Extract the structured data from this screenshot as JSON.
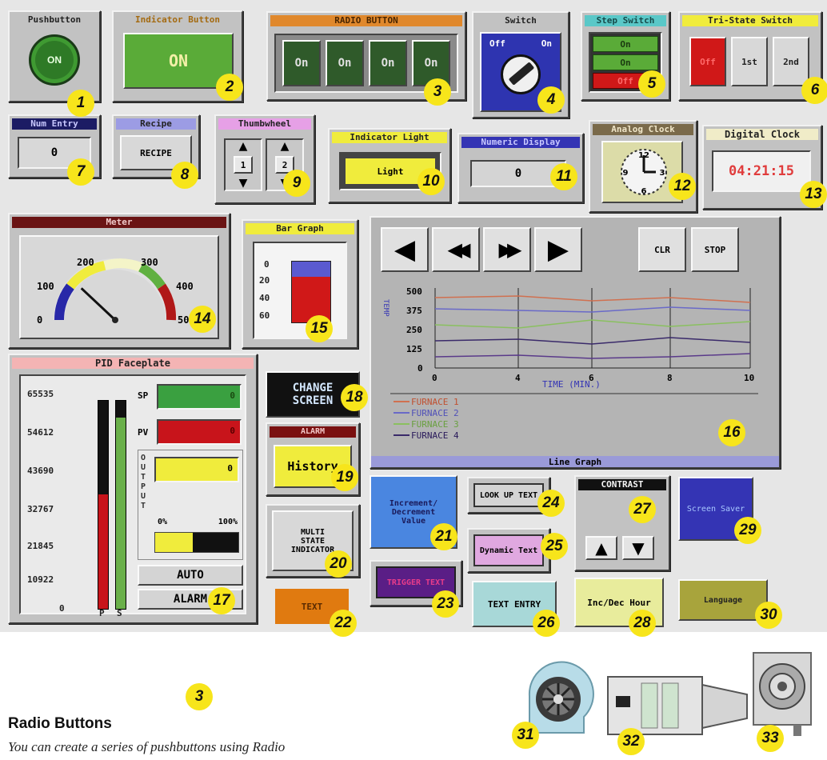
{
  "pushbutton": {
    "title": "Pushbutton",
    "label": "ON"
  },
  "indicator_button": {
    "title": "Indicator Button",
    "label": "ON"
  },
  "radio": {
    "title": "RADIO BUTTON",
    "labels": [
      "On",
      "On",
      "On",
      "On"
    ]
  },
  "switch": {
    "title": "Switch",
    "off": "Off",
    "on": "On"
  },
  "step_switch": {
    "title": "Step Switch",
    "labels": [
      "On",
      "On",
      "Off"
    ]
  },
  "tristate": {
    "title": "Tri-State Switch",
    "labels": [
      "Off",
      "1st",
      "2nd"
    ]
  },
  "num_entry": {
    "title": "Num Entry",
    "value": "0"
  },
  "recipe": {
    "title": "Recipe",
    "label": "RECIPE"
  },
  "thumbwheel": {
    "title": "Thumbwheel",
    "digits": [
      "1",
      "2"
    ]
  },
  "indicator_light": {
    "title": "Indicator Light",
    "label": "Light"
  },
  "numeric_display": {
    "title": "Numeric Display",
    "value": "0"
  },
  "analog_clock": {
    "title": "Analog Clock",
    "marks": [
      "12",
      "3",
      "6",
      "9"
    ]
  },
  "digital_clock": {
    "title": "Digital Clock",
    "time": "04:21:15"
  },
  "meter": {
    "title": "Meter",
    "scale": [
      "0",
      "100",
      "200",
      "300",
      "400",
      "500"
    ],
    "value": 120
  },
  "bar_graph": {
    "title": "Bar Graph",
    "scale": [
      "0",
      "20",
      "40",
      "60"
    ],
    "value": 45
  },
  "line_graph": {
    "footer": "Line Graph",
    "clr": "CLR",
    "stop": "STOP",
    "ylabel": "TEMP",
    "xlabel": "TIME (MIN.)",
    "yticks": [
      "500",
      "375",
      "250",
      "125",
      "0"
    ],
    "xticks": [
      "0",
      "4",
      "6",
      "8",
      "10"
    ],
    "legend": [
      "FURNACE 1",
      "FURNACE 2",
      "FURNACE 3",
      "FURNACE 4"
    ]
  },
  "pid": {
    "title": "PID Faceplate",
    "scale": [
      "65535",
      "54612",
      "43690",
      "32767",
      "21845",
      "10922",
      "0"
    ],
    "sp": "SP",
    "pv": "PV",
    "sp_value": "0",
    "pv_value": "0",
    "out_value": "0",
    "output_letters": [
      "O",
      "U",
      "T",
      "P",
      "U",
      "T"
    ],
    "pct0": "0%",
    "pct100": "100%",
    "auto": "AUTO",
    "alarm": "ALARM",
    "p": "P",
    "s": "S",
    "p_fill": 0.55,
    "s_fill": 0.92,
    "out_fill": 0.45
  },
  "change_screen": {
    "line1": "CHANGE",
    "line2": "SCREEN"
  },
  "alarm_history": {
    "title": "ALARM",
    "label": "History"
  },
  "multistate": {
    "lines": [
      "MULTI",
      "STATE",
      "INDICATOR"
    ]
  },
  "text_obj": {
    "label": "TEXT"
  },
  "increment": {
    "label": "Increment/ Decrement Value"
  },
  "trigger": {
    "label": "TRIGGER TEXT"
  },
  "lookup": {
    "label": "LOOK UP TEXT"
  },
  "dynamic": {
    "label": "Dynamic Text"
  },
  "text_entry": {
    "label": "TEXT ENTRY"
  },
  "contrast": {
    "title": "CONTRAST"
  },
  "incdec_hour": {
    "label": "Inc/Dec Hour"
  },
  "screen_saver": {
    "label": "Screen Saver"
  },
  "language": {
    "label": "Language"
  },
  "numbers": [
    "1",
    "2",
    "3",
    "4",
    "5",
    "6",
    "7",
    "8",
    "9",
    "10",
    "11",
    "12",
    "13",
    "14",
    "15",
    "16",
    "17",
    "18",
    "19",
    "20",
    "21",
    "22",
    "23",
    "24",
    "25",
    "26",
    "27",
    "28",
    "29",
    "30",
    "31",
    "32",
    "33"
  ],
  "section": {
    "heading": "Radio Buttons",
    "badge": "3",
    "body": "You can create a series of pushbuttons using Radio"
  },
  "colors": {
    "panel": "#c2c2c2",
    "green": "#3f8a2f",
    "dark_green": "#2f5a2a",
    "red": "#c8141b",
    "yellow": "#f0ec3c",
    "badge": "#f7e51b",
    "blue": "#3434b4"
  }
}
